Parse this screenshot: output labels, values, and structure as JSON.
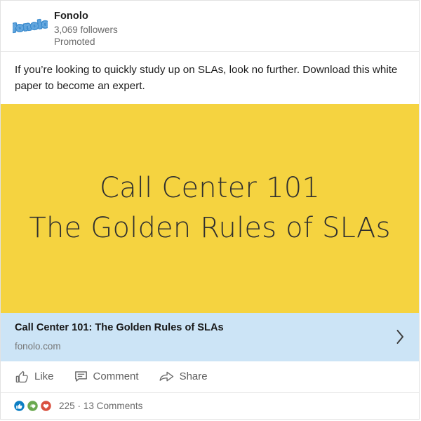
{
  "post": {
    "header": {
      "avatar_icon": "fonolo-logo",
      "actor_name": "Fonolo",
      "followers": "3,069 followers",
      "promoted_label": "Promoted"
    },
    "commentary": "If you’re looking to quickly study up on SLAs, look no further. Download this white paper to become an expert.",
    "hero_image": {
      "background_color": "#F5D340",
      "text_color": "#2f2f2f",
      "lines": [
        "Call Center 101",
        "The Golden Rules of SLAs"
      ]
    },
    "link_card": {
      "background_color": "#CCE4F6",
      "title": "Call Center 101: The Golden Rules of SLAs",
      "domain": "fonolo.com",
      "chevron_icon": "chevron-right-icon"
    },
    "actions": [
      {
        "label": "Like",
        "icon": "thumbs-up-icon"
      },
      {
        "label": "Comment",
        "icon": "comment-bubble-icon"
      },
      {
        "label": "Share",
        "icon": "share-arrow-icon"
      }
    ],
    "reactions": {
      "icons": [
        {
          "name": "reaction-like-icon",
          "color": "#0b7ec4"
        },
        {
          "name": "reaction-celebrate-icon",
          "color": "#6aa84f"
        },
        {
          "name": "reaction-love-icon",
          "color": "#d9503f"
        }
      ],
      "count": "225",
      "separator": "·",
      "comments": "13 Comments"
    }
  }
}
